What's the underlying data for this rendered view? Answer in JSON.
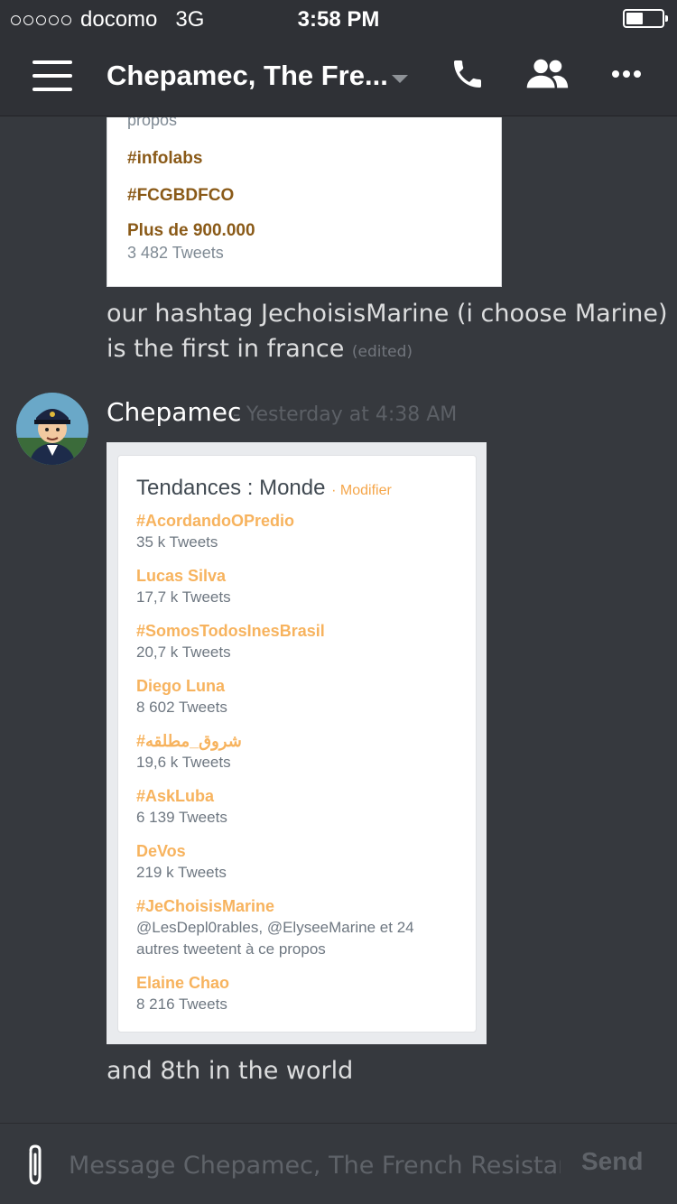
{
  "status_bar": {
    "carrier": "docomo",
    "network": "3G",
    "time": "3:58 PM"
  },
  "header": {
    "title": "Chepamec, The Fre...",
    "icons": [
      "menu-icon",
      "phone-icon",
      "members-icon",
      "more-icon"
    ]
  },
  "messages": {
    "first_card": {
      "partial_top": "propos",
      "trends": [
        {
          "name": "#infolabs"
        },
        {
          "name": "#FCGBDFCO"
        },
        {
          "name": "Plus de 900.000",
          "count": "3 482 Tweets"
        }
      ]
    },
    "first_message": {
      "line1": "our hashtag JechoisisMarine (i choose Marine)",
      "line2": "is the first in france",
      "edited": "(edited)"
    },
    "second_group": {
      "author": "Chepamec",
      "timestamp": "- Yesterday at 4:38 AM",
      "card": {
        "title": "Tendances : Monde",
        "modify": "· Modifier",
        "trends": [
          {
            "name": "#AcordandoOPredio",
            "count": "35 k Tweets"
          },
          {
            "name": "Lucas Silva",
            "count": "17,7 k Tweets"
          },
          {
            "name": "#SomosTodosInesBrasil",
            "count": "20,7 k Tweets"
          },
          {
            "name": "Diego Luna",
            "count": "8 602 Tweets"
          },
          {
            "name": "#شروق_مطلقه",
            "count": "19,6 k Tweets"
          },
          {
            "name": "#AskLuba",
            "count": "6 139 Tweets"
          },
          {
            "name": "DeVos",
            "count": "219 k Tweets"
          },
          {
            "name": "#JeChoisisMarine",
            "count": "@LesDepl0rables, @ElyseeMarine et 24",
            "count2": "autres tweetent à ce propos"
          },
          {
            "name": "Elaine Chao",
            "count": "8 216 Tweets"
          }
        ]
      },
      "message": "and 8th in the world"
    }
  },
  "composer": {
    "placeholder": "Message Chepamec, The French Resistan...",
    "send_label": "Send"
  },
  "colors": {
    "background": "#36393e",
    "header": "#2f3136",
    "trend_orange": "#f7b35e",
    "trend_brown": "#8a5a18"
  }
}
